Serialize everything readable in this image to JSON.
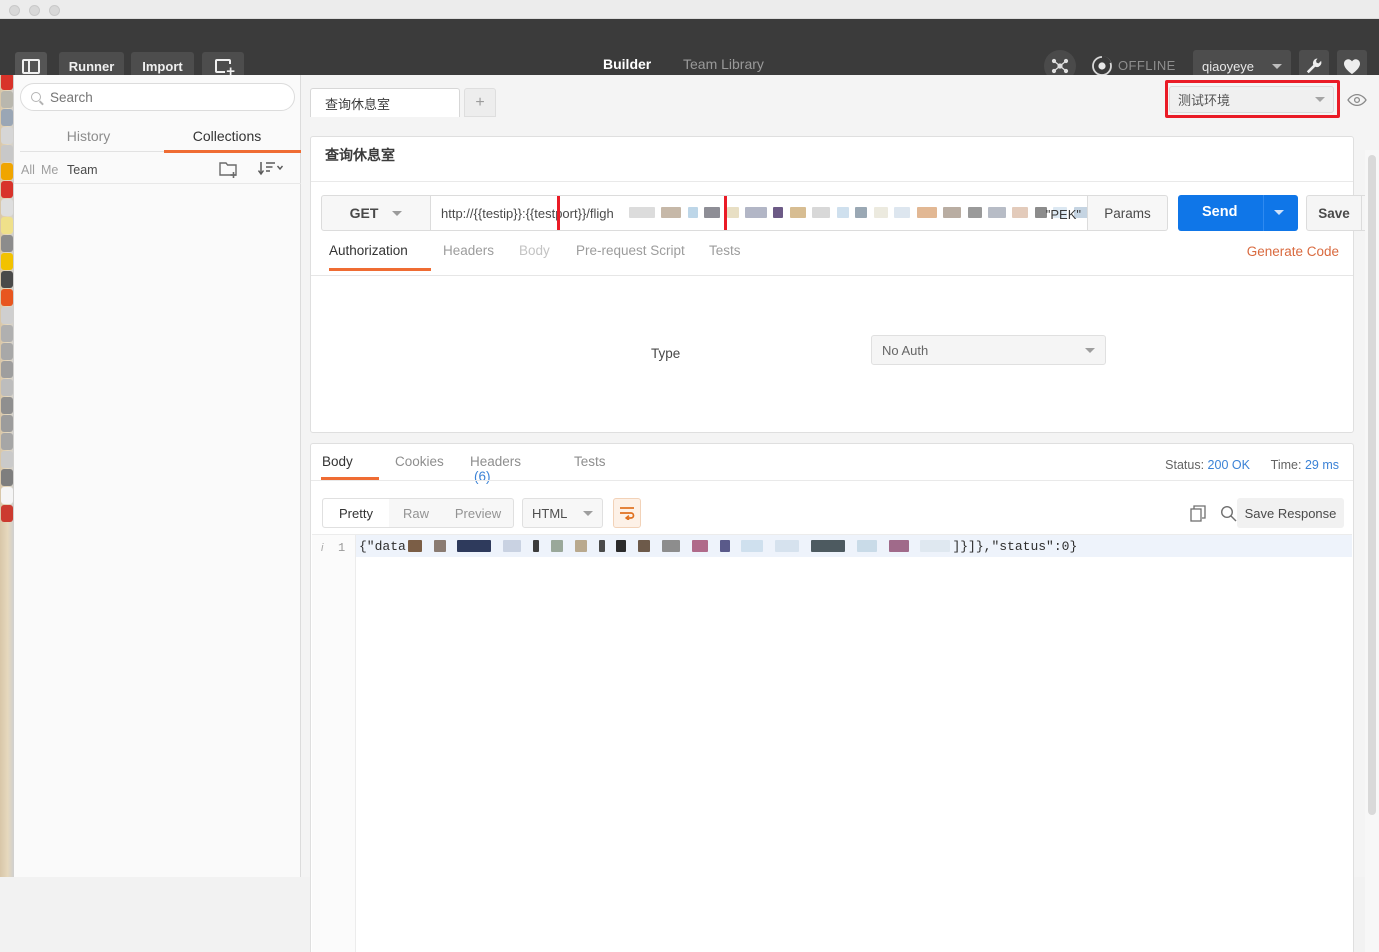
{
  "window": {
    "traffic_lights": [
      "close",
      "minimize",
      "maximize"
    ]
  },
  "topbar": {
    "sidebar_toggle_icon": "sidebar-toggle-icon",
    "runner_label": "Runner",
    "import_label": "Import",
    "new_tab_icon": "new-document-icon",
    "tabs": [
      {
        "label": "Builder",
        "active": true
      },
      {
        "label": "Team Library",
        "active": false
      }
    ],
    "nodes_icon": "network-nodes-icon",
    "sync_icon": "sync-status-icon",
    "offline_label": "OFFLINE",
    "user_name": "qiaoyeye",
    "wrench_icon": "wrench-icon",
    "heart_icon": "heart-icon",
    "accent_orange": "#f26b3a",
    "background": "#3b3b3b"
  },
  "sidebar": {
    "search_placeholder": "Search",
    "search_value": "",
    "search_icon": "search-icon",
    "tabs": [
      {
        "label": "History",
        "active": false
      },
      {
        "label": "Collections",
        "active": true
      }
    ],
    "filters": [
      {
        "label": "All",
        "active": false
      },
      {
        "label": "Me",
        "active": false
      },
      {
        "label": "Team",
        "active": true
      }
    ],
    "new_folder_icon": "new-folder-icon",
    "sort_icon": "sort-icon",
    "items": []
  },
  "tabstrip": {
    "request_tab_label": "查询休息室",
    "new_tab_label": "+",
    "environment_value": "测试环境",
    "eye_icon": "eye-icon",
    "highlight_color": "#ea1b26"
  },
  "request": {
    "title": "查询休息室",
    "method": "GET",
    "url_prefix": "http://{{testip}}:{{testport}}/fligh",
    "url_suffix": "\"PEK\"",
    "params_label": "Params",
    "send_label": "Send",
    "save_label": "Save",
    "tabs": [
      {
        "label": "Authorization",
        "state": "active"
      },
      {
        "label": "Headers",
        "state": "normal"
      },
      {
        "label": "Body",
        "state": "dimmed"
      },
      {
        "label": "Pre-request Script",
        "state": "normal"
      },
      {
        "label": "Tests",
        "state": "normal"
      }
    ],
    "generate_code_label": "Generate Code",
    "auth_type_label": "Type",
    "auth_type_value": "No Auth"
  },
  "response": {
    "tabs": [
      {
        "label": "Body",
        "active": true,
        "badge": ""
      },
      {
        "label": "Cookies",
        "active": false,
        "badge": ""
      },
      {
        "label": "Headers",
        "active": false,
        "badge": "(6)"
      },
      {
        "label": "Tests",
        "active": false,
        "badge": ""
      }
    ],
    "status_label": "Status:",
    "status_value": "200 OK",
    "time_label": "Time:",
    "time_value": "29 ms",
    "view_modes": [
      {
        "label": "Pretty",
        "active": true
      },
      {
        "label": "Raw",
        "active": false
      },
      {
        "label": "Preview",
        "active": false
      }
    ],
    "format_value": "HTML",
    "wrap_icon": "wrap-lines-icon",
    "copy_icon": "copy-icon",
    "search_icon": "search-icon",
    "save_response_label": "Save Response",
    "line_number": "1",
    "body_prefix": "{\"data",
    "body_suffix": "]}]},\"status\":0}"
  }
}
